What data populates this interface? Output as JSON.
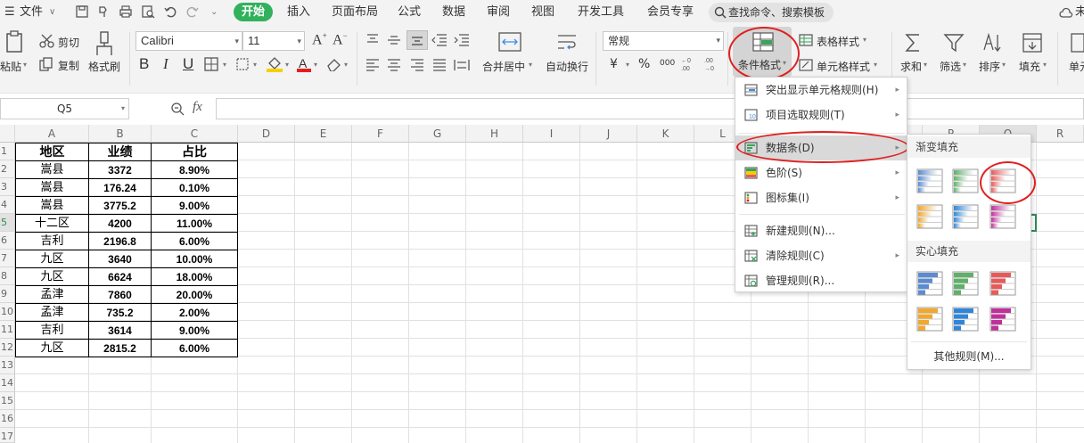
{
  "menubar": {
    "file": "文件",
    "tabs": [
      "开始",
      "插入",
      "页面布局",
      "公式",
      "数据",
      "审阅",
      "视图",
      "开发工具",
      "会员专享"
    ],
    "search": "查找命令、搜索模板",
    "right_text": "未"
  },
  "ribbon": {
    "paste": "粘贴",
    "cut": "剪切",
    "copy": "复制",
    "format_painter": "格式刷",
    "font_name": "Calibri",
    "font_size": "11",
    "font_grow": "A",
    "font_shrink": "A",
    "bold": "B",
    "italic": "I",
    "underline": "U",
    "merge_center": "合并居中",
    "wrap_text": "自动换行",
    "number_format": "常规",
    "currency": "¥",
    "percent": "%",
    "thousands": "000",
    "cond_format": "条件格式",
    "table_style": "表格样式",
    "cell_style": "单元格样式",
    "sum": "求和",
    "filter": "筛选",
    "sort": "排序",
    "fill": "填充",
    "cell_more": "单元"
  },
  "formula_bar": {
    "name_box": "Q5",
    "fx": "fx"
  },
  "grid": {
    "columns": [
      "A",
      "B",
      "C",
      "D",
      "E",
      "F",
      "G",
      "H",
      "I",
      "J",
      "K",
      "L",
      "M",
      "N",
      "O",
      "P",
      "Q",
      "R"
    ],
    "rows": [
      "1",
      "2",
      "3",
      "4",
      "5",
      "6",
      "7",
      "8",
      "9",
      "10",
      "11",
      "12",
      "13",
      "14",
      "15",
      "16",
      "17"
    ],
    "table_header": [
      "地区",
      "业绩",
      "占比"
    ],
    "table_rows": [
      [
        "嵩县",
        "3372",
        "8.90%"
      ],
      [
        "嵩县",
        "176.24",
        "0.10%"
      ],
      [
        "嵩县",
        "3775.2",
        "9.00%"
      ],
      [
        "十二区",
        "4200",
        "11.00%"
      ],
      [
        "吉利",
        "2196.8",
        "6.00%"
      ],
      [
        "九区",
        "3640",
        "10.00%"
      ],
      [
        "九区",
        "6624",
        "18.00%"
      ],
      [
        "孟津",
        "7860",
        "20.00%"
      ],
      [
        "孟津",
        "735.2",
        "2.00%"
      ],
      [
        "吉利",
        "3614",
        "9.00%"
      ],
      [
        "九区",
        "2815.2",
        "6.00%"
      ]
    ]
  },
  "cf_menu": {
    "items": [
      "突出显示单元格规则(H)",
      "项目选取规则(T)",
      "数据条(D)",
      "色阶(S)",
      "图标集(I)",
      "新建规则(N)...",
      "清除规则(C)",
      "管理规则(R)..."
    ]
  },
  "databar_menu": {
    "gradient_title": "渐变填充",
    "solid_title": "实心填充",
    "more_rules": "其他规则(M)...",
    "colors": [
      "#5b8bd0",
      "#5fb06a",
      "#e85a5a",
      "#f0a830",
      "#2f86d8",
      "#c0309a"
    ]
  }
}
